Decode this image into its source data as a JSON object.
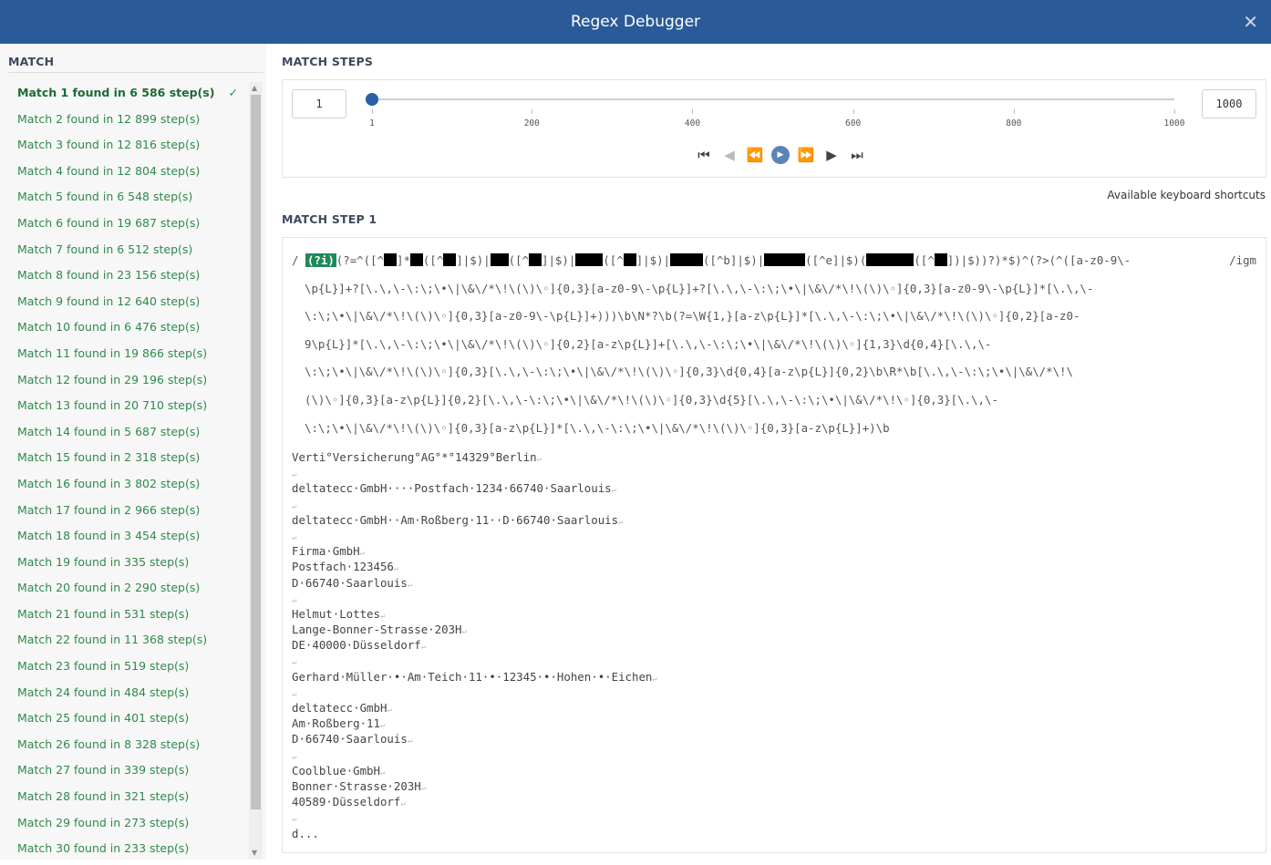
{
  "header": {
    "title": "Regex Debugger",
    "close_icon": "close-icon"
  },
  "match_panel": {
    "title": "MATCH",
    "items": [
      "Match 1 found in 6 586 step(s)",
      "Match 2 found in 12 899 step(s)",
      "Match 3 found in 12 816 step(s)",
      "Match 4 found in 12 804 step(s)",
      "Match 5 found in 6 548 step(s)",
      "Match 6 found in 19 687 step(s)",
      "Match 7 found in 6 512 step(s)",
      "Match 8 found in 23 156 step(s)",
      "Match 9 found in 12 640 step(s)",
      "Match 10 found in 6 476 step(s)",
      "Match 11 found in 19 866 step(s)",
      "Match 12 found in 29 196 step(s)",
      "Match 13 found in 20 710 step(s)",
      "Match 14 found in 5 687 step(s)",
      "Match 15 found in 2 318 step(s)",
      "Match 16 found in 3 802 step(s)",
      "Match 17 found in 2 966 step(s)",
      "Match 18 found in 3 454 step(s)",
      "Match 19 found in 335 step(s)",
      "Match 20 found in 2 290 step(s)",
      "Match 21 found in 531 step(s)",
      "Match 22 found in 11 368 step(s)",
      "Match 23 found in 519 step(s)",
      "Match 24 found in 484 step(s)",
      "Match 25 found in 401 step(s)",
      "Match 26 found in 8 328 step(s)",
      "Match 27 found in 339 step(s)",
      "Match 28 found in 321 step(s)",
      "Match 29 found in 273 step(s)",
      "Match 30 found in 233 step(s)"
    ],
    "selected_index": 0,
    "check_mark": "✓"
  },
  "steps": {
    "title": "MATCH STEPS",
    "current": "1",
    "max": "1000",
    "slider_value": 1,
    "slider_min": 1,
    "slider_max": 1000,
    "ticks": [
      "1",
      "200",
      "400",
      "600",
      "800",
      "1000"
    ],
    "controls": [
      "first-step",
      "prev-step",
      "rewind",
      "play",
      "fast-forward",
      "next-step",
      "last-step"
    ],
    "shortcuts_link": "Available keyboard shortcuts"
  },
  "step": {
    "title": "MATCH STEP 1",
    "delimiter": "/",
    "highlight": "(?i)",
    "flags": "/igm",
    "first_line": [
      "(?=^([^",
      null,
      "]*",
      null,
      "([^",
      null,
      "]|$)|",
      null,
      "([^",
      null,
      "]|$)|",
      null,
      "([^",
      null,
      "]|$)|",
      null,
      "([^b]|$)|",
      null,
      "([^e]|$)(",
      null,
      "([^",
      null,
      "])|$))?)*$)^(?>(^([a-z0-9\\-"
    ],
    "regex_lines": [
      "\\p{L}]+?[\\.\\,\\-\\:\\;\\•\\|\\&\\/*\\!\\(\\)\\◦]{0,3}[a-z0-9\\-\\p{L}]+?[\\.\\,\\-\\:\\;\\•\\|\\&\\/*\\!\\(\\)\\◦]{0,3}[a-z0-9\\-\\p{L}]*[\\.\\,\\-",
      "\\:\\;\\•\\|\\&\\/*\\!\\(\\)\\◦]{0,3}[a-z0-9\\-\\p{L}]+)))\\b\\N*?\\b(?=\\W{1,}[a-z\\p{L}]*[\\.\\,\\-\\:\\;\\•\\|\\&\\/*\\!\\(\\)\\◦]{0,2}[a-z0-",
      "9\\p{L}]*[\\.\\,\\-\\:\\;\\•\\|\\&\\/*\\!\\(\\)\\◦]{0,2}[a-z\\p{L}]+[\\.\\,\\-\\:\\;\\•\\|\\&\\/*\\!\\(\\)\\◦]{1,3}\\d{0,4}[\\.\\,\\-",
      "\\:\\;\\•\\|\\&\\/*\\!\\(\\)\\◦]{0,3}[\\.\\,\\-\\:\\;\\•\\|\\&\\/*\\!\\(\\)\\◦]{0,3}\\d{0,4}[a-z\\p{L}]{0,2}\\b\\R*\\b[\\.\\,\\-\\:\\;\\•\\|\\&\\/*\\!\\",
      "(\\)\\◦]{0,3}[a-z\\p{L}]{0,2}[\\.\\,\\-\\:\\;\\•\\|\\&\\/*\\!\\(\\)\\◦]{0,3}\\d{5}[\\.\\,\\-\\:\\;\\•\\|\\&\\/*\\!\\◦]{0,3}[\\.\\,\\-",
      "\\:\\;\\•\\|\\&\\/*\\!\\(\\)\\◦]{0,3}[a-z\\p{L}]*[\\.\\,\\-\\:\\;\\•\\|\\&\\/*\\!\\(\\)\\◦]{0,3}[a-z\\p{L}]+)\\b"
    ],
    "test_lines": [
      "Verti°Versicherung°AG°*°14329°Berlin",
      "",
      "deltatecc·GmbH····Postfach·1234·66740·Saarlouis",
      "",
      "deltatecc·GmbH··Am·Roßberg·11··D·66740·Saarlouis",
      "",
      "Firma·GmbH",
      "Postfach·123456",
      "D·66740·Saarlouis",
      "",
      "Helmut·Lottes",
      "Lange-Bonner-Strasse·203H",
      "DE·40000·Düsseldorf",
      "",
      "Gerhard·Müller·•·Am·Teich·11·•·12345·•·Hohen·•·Eichen",
      "",
      "deltatecc·GmbH",
      "Am·Roßberg·11",
      "D·66740·Saarlouis",
      "",
      "Coolblue·GmbH",
      "Bonner·Strasse·203H",
      "40589·Düsseldorf",
      "",
      "d..."
    ],
    "line_end_mark": "↵"
  }
}
